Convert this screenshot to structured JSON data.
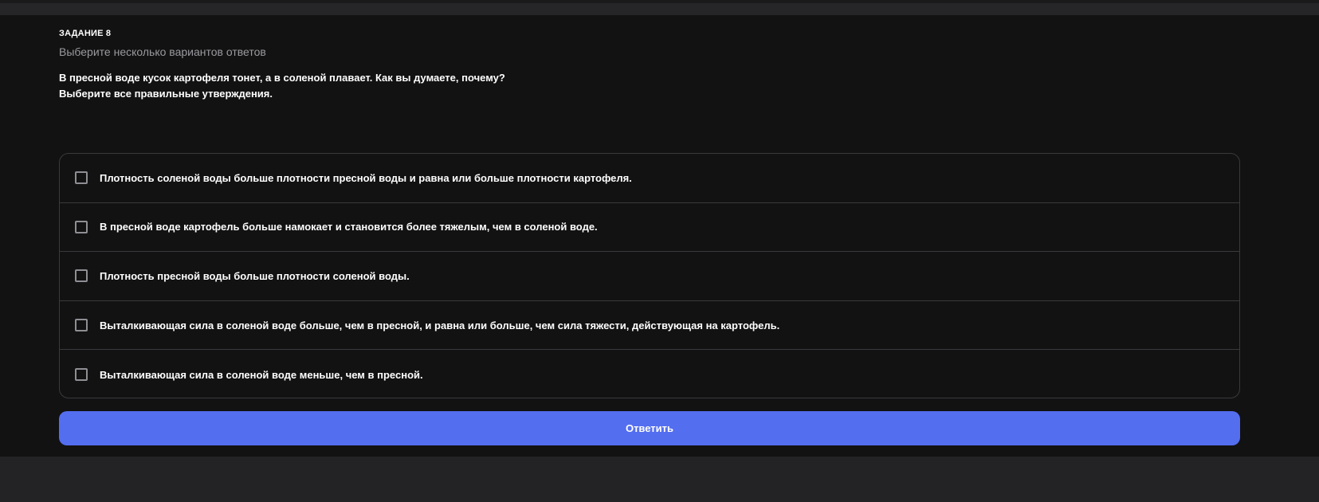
{
  "task": {
    "label": "ЗАДАНИЕ 8",
    "instruction": "Выберите несколько вариантов ответов",
    "question_line1": "В пресной воде кусок картофеля тонет, а в соленой плавает. Как вы думаете, почему?",
    "question_line2": "Выберите все правильные утверждения."
  },
  "options": [
    {
      "label": "Плотность соленой воды больше плотности пресной воды и равна или больше плотности картофеля.",
      "checked": false
    },
    {
      "label": "В пресной воде картофель больше намокает и становится более тяжелым, чем в соленой воде.",
      "checked": false
    },
    {
      "label": "Плотность пресной воды больше плотности соленой воды.",
      "checked": false
    },
    {
      "label": "Выталкивающая сила в соленой воде больше, чем в пресной, и равна или больше, чем сила тяжести, действующая на картофель.",
      "checked": false
    },
    {
      "label": "Выталкивающая сила в соленой воде меньше, чем в пресной.",
      "checked": false
    }
  ],
  "submit": {
    "label": "Ответить"
  },
  "colors": {
    "accent": "#546ef0",
    "panel_background": "#121212",
    "page_background": "#232325"
  }
}
